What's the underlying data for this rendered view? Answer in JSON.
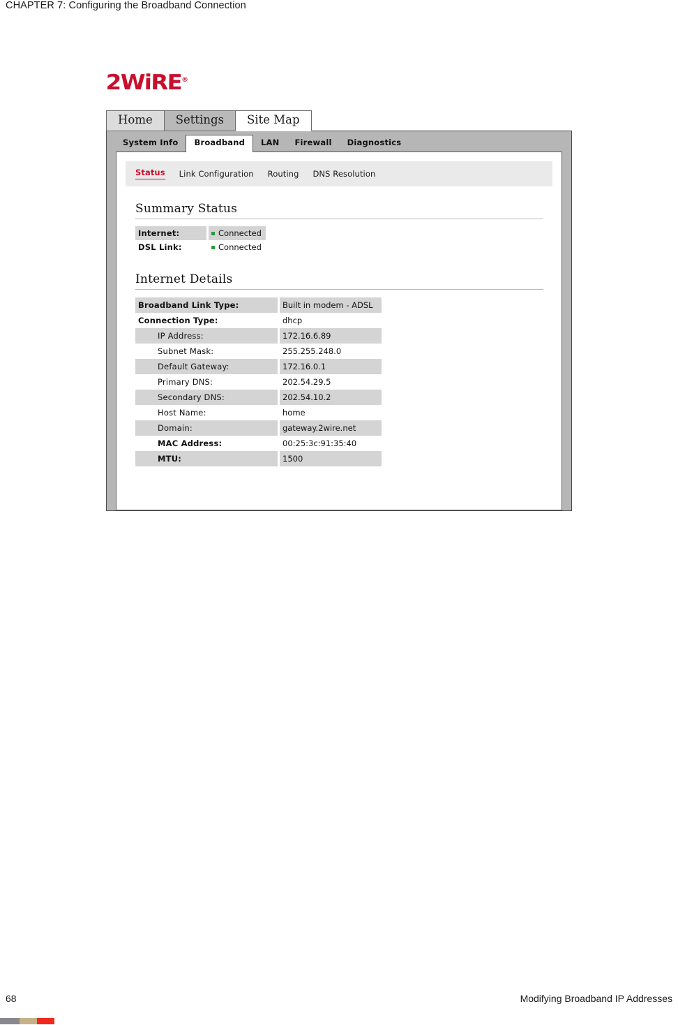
{
  "document": {
    "header": "CHAPTER 7: Configuring the Broadband Connection",
    "footer_page": "68",
    "footer_title": "Modifying Broadband IP Addresses",
    "footer_bar_colors": [
      "#88888e",
      "#c7b188",
      "#f0291f"
    ]
  },
  "screenshot": {
    "logo": {
      "text": "2WiRE",
      "registered_mark": "®",
      "color": "#c8102e"
    },
    "top_nav": [
      {
        "label": "Home",
        "state": "inactive"
      },
      {
        "label": "Settings",
        "state": "hover"
      },
      {
        "label": "Site Map",
        "state": "active"
      }
    ],
    "sub_nav": [
      {
        "label": "System Info",
        "state": "inactive"
      },
      {
        "label": "Broadband",
        "state": "active"
      },
      {
        "label": "LAN",
        "state": "inactive"
      },
      {
        "label": "Firewall",
        "state": "inactive"
      },
      {
        "label": "Diagnostics",
        "state": "inactive"
      }
    ],
    "tertiary_nav": [
      {
        "label": "Status",
        "state": "active",
        "color": "#c8102e"
      },
      {
        "label": "Link Configuration",
        "state": "inactive"
      },
      {
        "label": "Routing",
        "state": "inactive"
      },
      {
        "label": "DNS Resolution",
        "state": "inactive"
      }
    ],
    "summary_status": {
      "heading": "Summary Status",
      "rows": [
        {
          "label": "Internet:",
          "value": "Connected",
          "indicator": "green-dot",
          "shaded": true
        },
        {
          "label": "DSL Link:",
          "value": "Connected",
          "indicator": "green-dot",
          "shaded": false
        }
      ],
      "indicator_color": "#2c9a3c"
    },
    "internet_details": {
      "heading": "Internet Details",
      "rows": [
        {
          "label": "Broadband Link Type:",
          "value": "Built in modem - ADSL",
          "shaded": true,
          "bold": true,
          "indent": false
        },
        {
          "label": "Connection Type:",
          "value": "dhcp",
          "shaded": false,
          "bold": true,
          "indent": false
        },
        {
          "label": "IP Address:",
          "value": "172.16.6.89",
          "shaded": true,
          "bold": false,
          "indent": true
        },
        {
          "label": "Subnet Mask:",
          "value": "255.255.248.0",
          "shaded": false,
          "bold": false,
          "indent": true
        },
        {
          "label": "Default Gateway:",
          "value": "172.16.0.1",
          "shaded": true,
          "bold": false,
          "indent": true
        },
        {
          "label": "Primary DNS:",
          "value": "202.54.29.5",
          "shaded": false,
          "bold": false,
          "indent": true
        },
        {
          "label": "Secondary DNS:",
          "value": "202.54.10.2",
          "shaded": true,
          "bold": false,
          "indent": true
        },
        {
          "label": "Host Name:",
          "value": "home",
          "shaded": false,
          "bold": false,
          "indent": true
        },
        {
          "label": "Domain:",
          "value": "gateway.2wire.net",
          "shaded": true,
          "bold": false,
          "indent": true
        },
        {
          "label": "MAC Address:",
          "value": "00:25:3c:91:35:40",
          "shaded": false,
          "bold": true,
          "indent": true
        },
        {
          "label": "MTU:",
          "value": "1500",
          "shaded": true,
          "bold": true,
          "indent": true
        }
      ]
    }
  }
}
